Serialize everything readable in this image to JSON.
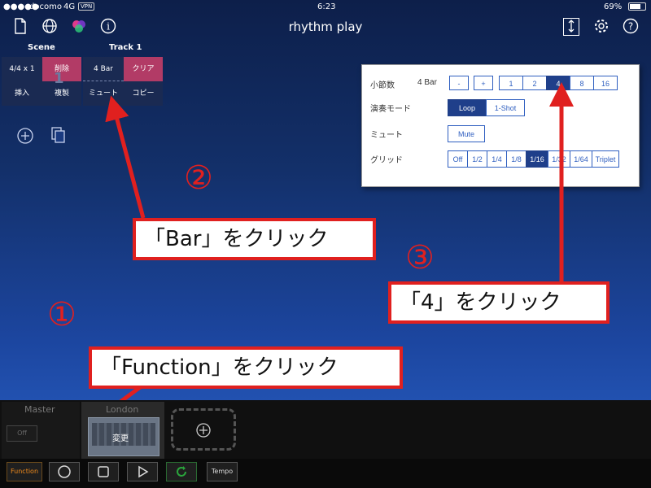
{
  "status": {
    "carrier": "docomo",
    "network": "4G",
    "vpn": "VPN",
    "time": "6:23",
    "battery": "69%",
    "battery_level": 0.69
  },
  "app": {
    "title": "rhythm play"
  },
  "icons": {
    "new_doc": "document-icon",
    "globe": "globe-icon",
    "colors": "color-wheel-icon",
    "info": "info-icon",
    "resize": "vertical-resize-icon",
    "settings": "gear-icon",
    "help": "help-icon",
    "add": "plus-icon",
    "duplicate": "duplicate-icon"
  },
  "scene": {
    "header": "Scene",
    "time_sig": "4/4 x 1",
    "delete": "削除",
    "insert": "挿入",
    "duplicate": "複製",
    "number": "1"
  },
  "track": {
    "header": "Track 1",
    "bars": "4 Bar",
    "clear": "クリア",
    "mute": "ミュート",
    "copy": "コピー"
  },
  "popup": {
    "bars_label": "小節数",
    "bars_value": "4 Bar",
    "minus": "-",
    "plus": "+",
    "bar_options": [
      "1",
      "2",
      "4",
      "8",
      "16"
    ],
    "bar_selected": "4",
    "mode_label": "演奏モード",
    "mode_options": [
      "Loop",
      "1-Shot"
    ],
    "mode_selected": "Loop",
    "mute_label": "ミュート",
    "mute_button": "Mute",
    "grid_label": "グリッド",
    "grid_options": [
      "Off",
      "1/2",
      "1/4",
      "1/8",
      "1/16",
      "1/32",
      "1/64",
      "Triplet"
    ],
    "grid_selected": "1/16"
  },
  "annotations": {
    "step1_num": "①",
    "step1_text": "「Function」をクリック",
    "step2_num": "②",
    "step2_text": "「Bar」をクリック",
    "step3_num": "③",
    "step3_text": "「4」をクリック"
  },
  "mixer": {
    "master": "Master",
    "master_off": "Off",
    "instrument": "London",
    "change": "変更"
  },
  "transport": {
    "function": "Function",
    "tempo": "Tempo"
  },
  "colors": {
    "accent_pink": "#b23b66",
    "arrow_red": "#e0201f",
    "function_orange": "#f08a1c",
    "selected_blue": "#1f3f8a",
    "loop_green": "#2aa53c"
  }
}
